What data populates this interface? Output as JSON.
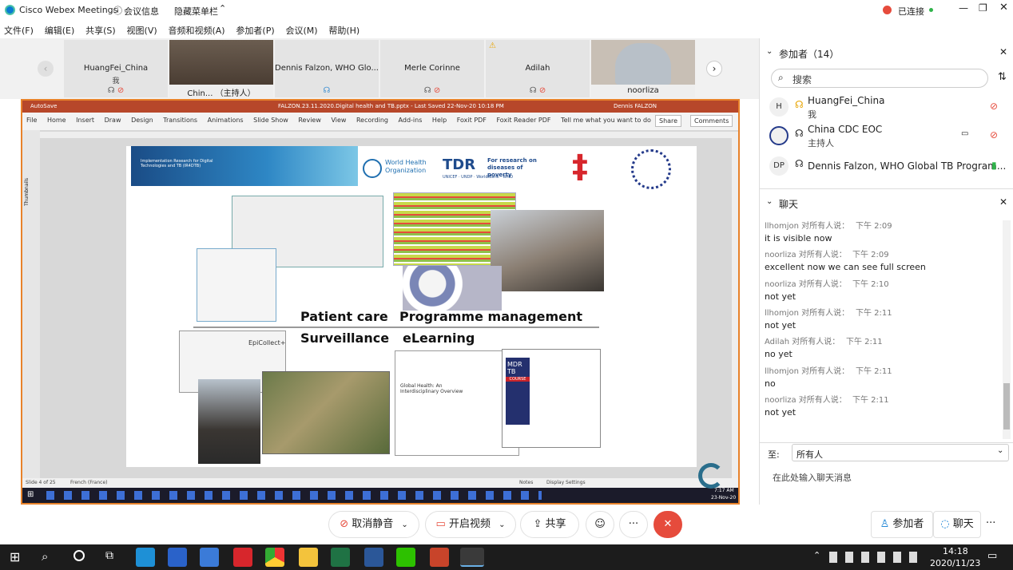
{
  "titlebar": {
    "app_title": "Cisco Webex Meetings",
    "meeting_info": "会议信息",
    "hide_menu": "隐藏菜单栏",
    "connected": "已连接"
  },
  "menu": [
    "文件(F)",
    "编辑(E)",
    "共享(S)",
    "视图(V)",
    "音频和视频(A)",
    "参加者(P)",
    "会议(M)",
    "帮助(H)"
  ],
  "thumbnails": [
    {
      "name": "HuangFei_China",
      "sub": "我"
    },
    {
      "name": "Chin... （主持人）",
      "sub": ""
    },
    {
      "name": "Dennis Falzon, WHO Glo...",
      "sub": ""
    },
    {
      "name": "Merle Corinne",
      "sub": ""
    },
    {
      "name": "Adilah",
      "sub": ""
    },
    {
      "name": "noorliza",
      "sub": ""
    }
  ],
  "ppt": {
    "title": "FALZON.23.11.2020.Digital health and TB.pptx  -  Last Saved 22-Nov-20 10:18 PM",
    "autosave": "AutoSave",
    "user": "Dennis FALZON",
    "tabs": [
      "File",
      "Home",
      "Insert",
      "Draw",
      "Design",
      "Transitions",
      "Animations",
      "Slide Show",
      "Review",
      "View",
      "Recording",
      "Add-ins",
      "Help",
      "Foxit PDF",
      "Foxit Reader PDF"
    ],
    "tell_me": "Tell me what you want to do",
    "share": "Share",
    "comments": "Comments",
    "thumbnails_label": "Thumbnails",
    "status_slide": "Slide 4 of 25",
    "status_lang": "French (France)",
    "status_notes": "Notes",
    "status_display": "Display Settings",
    "taskbar_time": "7:17 AM",
    "taskbar_date": "23-Nov-20"
  },
  "slide": {
    "banner_title": "Implementation Research for Digital Technologies and TB (IR4DTB)",
    "who": "World Health Organization",
    "tdr": "TDR",
    "tdr_sub": "For research on diseases of poverty",
    "tdr_sub2": "UNICEF · UNDP · World Bank · WHO",
    "patient_care": "Patient care",
    "surveillance": "Surveillance",
    "programme_management": "Programme management",
    "elearning": "eLearning",
    "epicollect": "EpiCollect+",
    "global_health": "Global Health: An Interdisciplinary Overview",
    "mdr_tb": "MDR TB",
    "course": "COURSE"
  },
  "participants": {
    "header": "参加者（14）",
    "search_placeholder": "搜索",
    "rows": [
      {
        "initials": "H",
        "name": "HuangFei_China",
        "role": "我"
      },
      {
        "initials": "",
        "name": "China CDC EOC",
        "role": "主持人"
      },
      {
        "initials": "DP",
        "name": "Dennis Falzon, WHO Global TB Program...",
        "role": ""
      }
    ]
  },
  "chat": {
    "header": "聊天",
    "messages": [
      {
        "meta": "llhomjon 对所有人说：",
        "time": "下午 2:09",
        "text": "it is visible now"
      },
      {
        "meta": "noorliza 对所有人说：",
        "time": "下午 2:09",
        "text": "excellent now we can see full screen"
      },
      {
        "meta": "noorliza 对所有人说：",
        "time": "下午 2:10",
        "text": "not yet"
      },
      {
        "meta": "llhomjon 对所有人说：",
        "time": "下午 2:11",
        "text": "not yet"
      },
      {
        "meta": "Adilah 对所有人说：",
        "time": "下午 2:11",
        "text": "no yet"
      },
      {
        "meta": "llhomjon 对所有人说：",
        "time": "下午 2:11",
        "text": "no"
      },
      {
        "meta": "noorliza 对所有人说：",
        "time": "下午 2:11",
        "text": "not yet"
      }
    ],
    "to_label": "至:",
    "to_value": "所有人",
    "input_placeholder": "在此处输入聊天消息"
  },
  "controls": {
    "unmute": "取消静音",
    "start_video": "开启视频",
    "share": "共享",
    "participants": "参加者",
    "chat": "聊天"
  },
  "wintaskbar": {
    "time": "14:18",
    "date": "2020/11/23"
  },
  "colors": {
    "accent_orange": "#e8822a",
    "end_red": "#e64b3c",
    "ppt_red": "#b7472a",
    "webex_blue": "#0a7bd2"
  }
}
